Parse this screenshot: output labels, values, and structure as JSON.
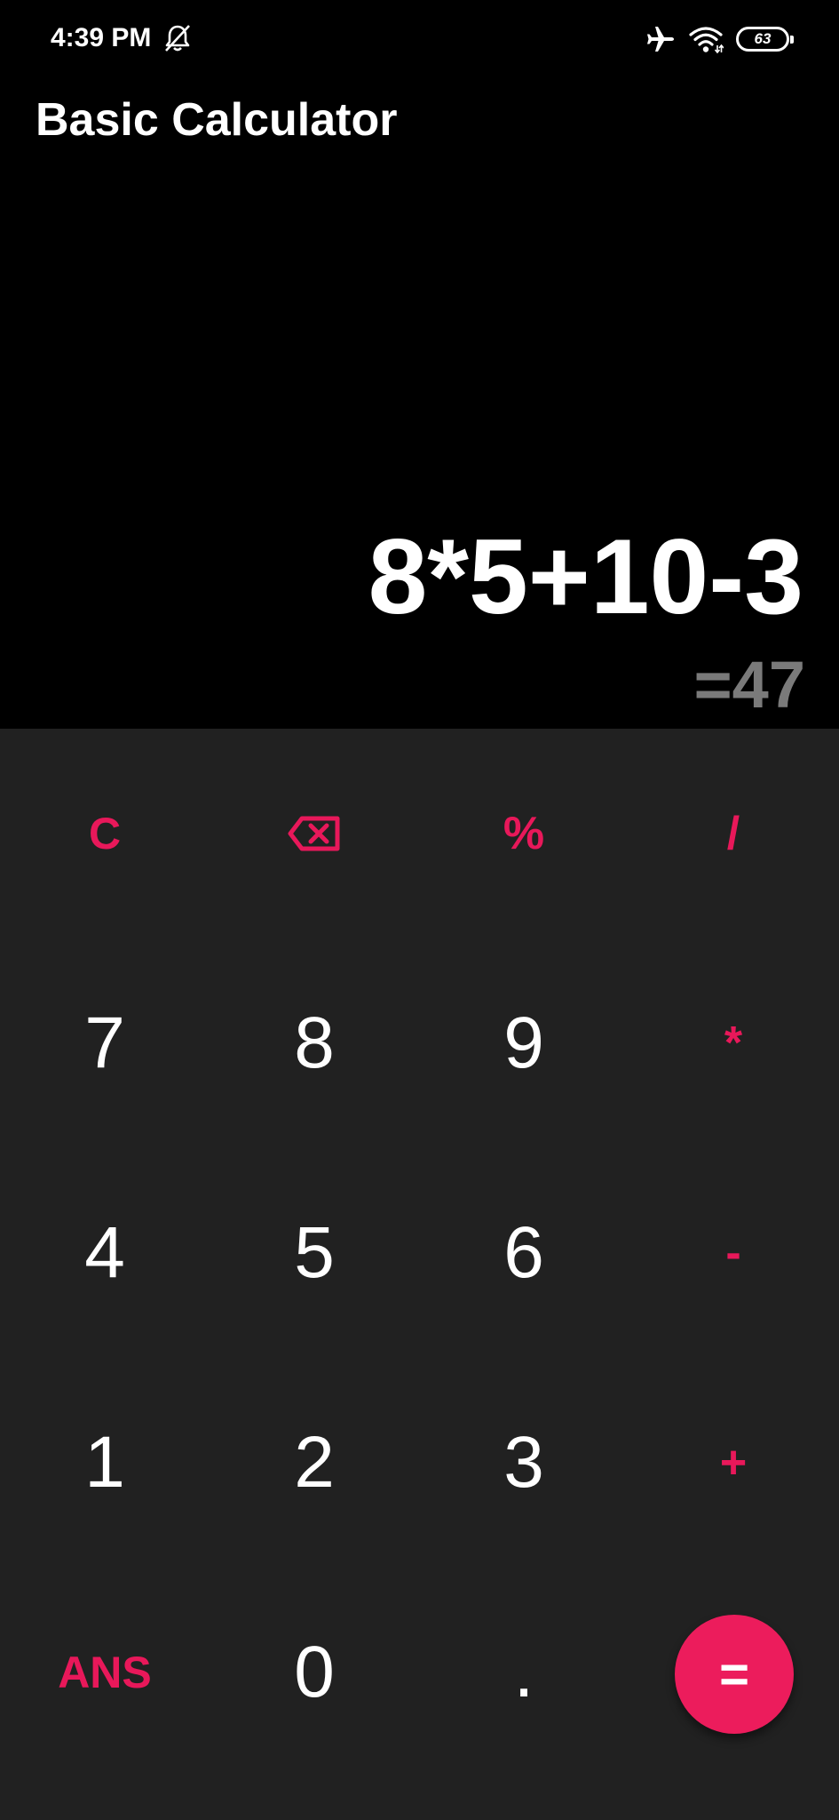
{
  "status_bar": {
    "time": "4:39 PM",
    "battery_level": "63",
    "icons": [
      "bell-off-icon",
      "airplane-icon",
      "wifi-icon",
      "battery-icon"
    ]
  },
  "app": {
    "title": "Basic Calculator"
  },
  "display": {
    "expression": "8*5+10-3",
    "result": "=47"
  },
  "colors": {
    "accent": "#e8185a",
    "keypad_background": "#212121",
    "display_background": "#000000",
    "result_text": "#7a7a7a"
  },
  "keys": {
    "clear": "C",
    "backspace": "backspace-icon",
    "percent": "%",
    "divide": "/",
    "seven": "7",
    "eight": "8",
    "nine": "9",
    "multiply": "*",
    "four": "4",
    "five": "5",
    "six": "6",
    "minus": "-",
    "one": "1",
    "two": "2",
    "three": "3",
    "plus": "+",
    "ans": "ANS",
    "zero": "0",
    "dot": ".",
    "equals": "="
  }
}
